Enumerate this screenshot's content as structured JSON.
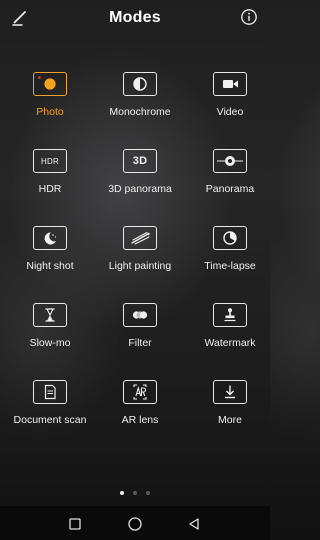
{
  "header": {
    "title": "Modes",
    "edit_icon": "edit-pencil-icon",
    "info_icon": "info-circle-icon"
  },
  "accent_color": "#f5a223",
  "modes": [
    {
      "label": "Photo",
      "icon": "photo-camera-icon",
      "active": true
    },
    {
      "label": "Monochrome",
      "icon": "monochrome-icon",
      "active": false
    },
    {
      "label": "Video",
      "icon": "video-camera-icon",
      "active": false
    },
    {
      "label": "HDR",
      "icon": "hdr-icon",
      "icon_text": "HDR",
      "active": false
    },
    {
      "label": "3D panorama",
      "icon": "3d-panorama-icon",
      "icon_text": "3D",
      "active": false
    },
    {
      "label": "Panorama",
      "icon": "panorama-icon",
      "active": false
    },
    {
      "label": "Night shot",
      "icon": "night-shot-icon",
      "active": false
    },
    {
      "label": "Light painting",
      "icon": "light-painting-icon",
      "active": false
    },
    {
      "label": "Time-lapse",
      "icon": "time-lapse-icon",
      "active": false
    },
    {
      "label": "Slow-mo",
      "icon": "slow-mo-hourglass-icon",
      "active": false
    },
    {
      "label": "Filter",
      "icon": "filter-icon",
      "active": false
    },
    {
      "label": "Watermark",
      "icon": "watermark-stamp-icon",
      "active": false
    },
    {
      "label": "Document scan",
      "icon": "document-scan-icon",
      "active": false
    },
    {
      "label": "AR lens",
      "icon": "ar-lens-icon",
      "active": false
    },
    {
      "label": "More",
      "icon": "download-more-icon",
      "active": false
    }
  ],
  "pager": {
    "pages": 3,
    "current": 1
  },
  "navbar": {
    "recent_icon": "recent-apps-square-icon",
    "home_icon": "home-circle-icon",
    "back_icon": "back-triangle-icon"
  }
}
